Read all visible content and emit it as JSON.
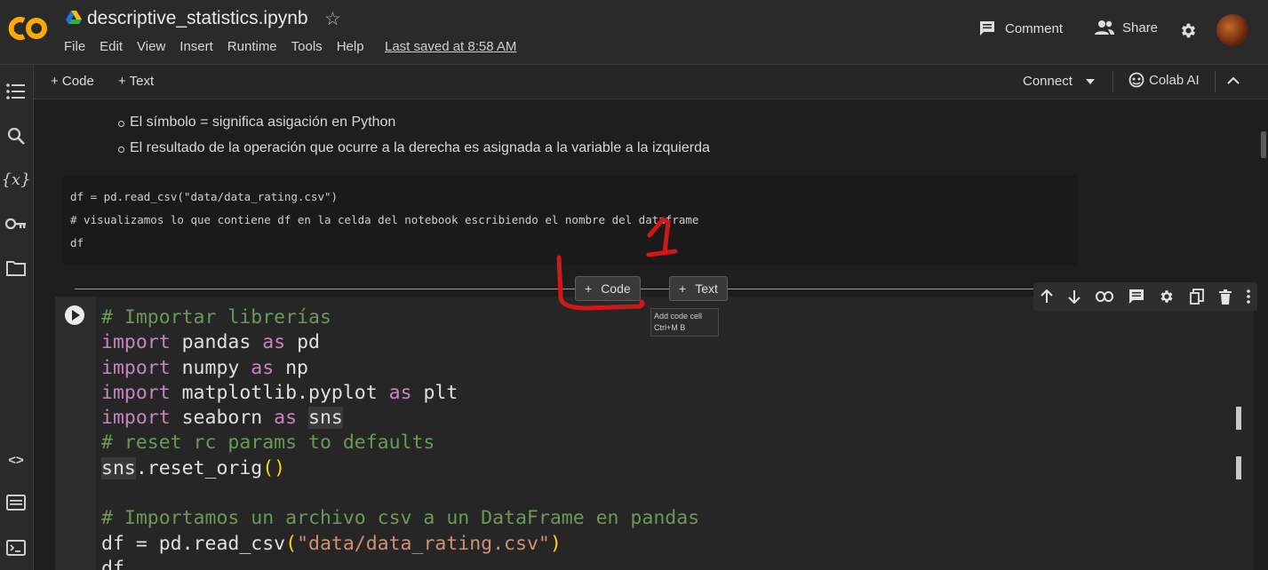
{
  "app": {
    "title": "descriptive_statistics.ipynb",
    "menus": [
      "File",
      "Edit",
      "View",
      "Insert",
      "Runtime",
      "Tools",
      "Help"
    ],
    "last_saved": "Last saved at 8:58 AM",
    "comment_label": "Comment",
    "share_label": "Share"
  },
  "toolbar": {
    "add_code": "+ Code",
    "add_text": "+ Text",
    "connect": "Connect",
    "colab_ai": "Colab AI"
  },
  "text_cell": {
    "bullets": [
      "El símbolo = significa asigación en Python",
      "El resultado de la operación que ocurre a la derecha es asignada a la variable a la izquierda"
    ]
  },
  "code_cell_1": {
    "lines": [
      "df = pd.read_csv(\"data/data_rating.csv\")",
      "# visualizamos lo que contiene df en la celda del notebook escribiendo el nombre del dataframe",
      "df"
    ]
  },
  "insert": {
    "code_label": "Code",
    "text_label": "Text",
    "tooltip_line1": "Add code cell",
    "tooltip_line2": "Ctrl+M B"
  },
  "annotation": {
    "number": "1",
    "color": "#d01818"
  },
  "code_cell_2": {
    "comment1": "# Importar librerías",
    "l1a": "import",
    "l1b": " pandas ",
    "l1c": "as",
    "l1d": " pd",
    "l2a": "import",
    "l2b": " numpy ",
    "l2c": "as",
    "l2d": " np",
    "l3a": "import",
    "l3b": " matplotlib.pyplot ",
    "l3c": "as",
    "l3d": " plt",
    "l4a": "import",
    "l4b": " seaborn ",
    "l4c": "as",
    "l4d": " ",
    "l4e": "sns",
    "comment2": "# reset rc params to defaults",
    "l6a": "sns",
    "l6b": ".reset_orig",
    "l6c": "()",
    "comment3": "# Importamos un archivo csv a un DataFrame en pandas",
    "l9a": "df = pd.read_csv",
    "l9b": "(",
    "l9c": "\"data/data_rating.csv\"",
    "l9d": ")",
    "l10": "df"
  },
  "colors": {
    "background": "#1e1e1e",
    "keyword": "#c586c0",
    "comment": "#6a9955",
    "string": "#ce9178",
    "logo": "#f9ab00"
  }
}
